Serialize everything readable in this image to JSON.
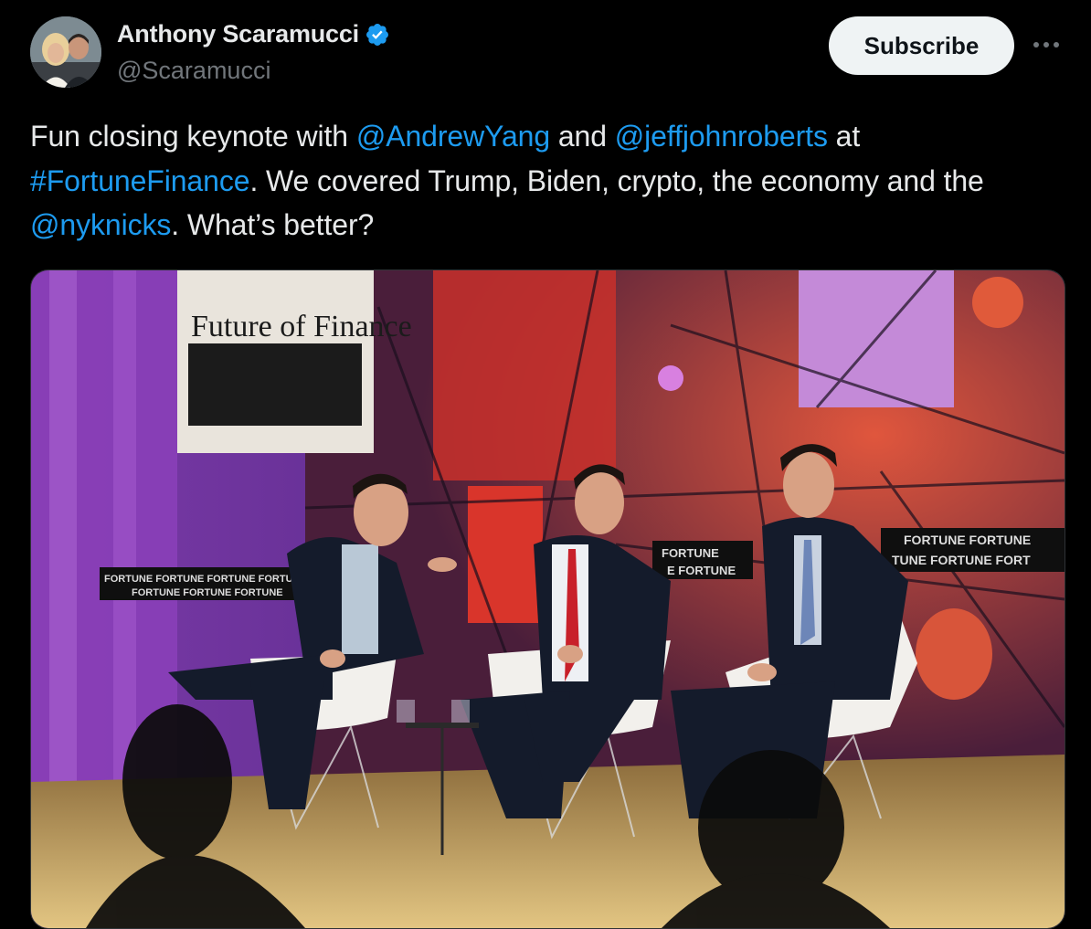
{
  "author": {
    "display_name": "Anthony Scaramucci",
    "handle": "@Scaramucci",
    "verified": true,
    "avatar_icon": "profile-photo"
  },
  "actions": {
    "subscribe_label": "Subscribe",
    "more_icon": "more-horizontal-icon"
  },
  "tweet": {
    "segments": [
      {
        "text": "Fun closing keynote with ",
        "type": "text"
      },
      {
        "text": "@AndrewYang",
        "type": "mention"
      },
      {
        "text": " and ",
        "type": "text"
      },
      {
        "text": "@jeffjohnroberts",
        "type": "mention"
      },
      {
        "text": " at ",
        "type": "text"
      },
      {
        "text": "#FortuneFinance",
        "type": "hashtag"
      },
      {
        "text": ". We covered Trump, Biden, crypto, the economy and the ",
        "type": "text"
      },
      {
        "text": "@nyknicks",
        "type": "mention"
      },
      {
        "text": ". What’s better?",
        "type": "text"
      }
    ]
  },
  "media": {
    "sign_text": "Future of Finance",
    "banner_left_row1": "FORTUNE  FORTUNE  FORTUNE  FORTU",
    "banner_left_row2": "FORTUNE  FORTUNE  FORTUNE",
    "banner_mid_row1": "FORTUNE",
    "banner_mid_row2": "E  FORTUNE",
    "banner_right_row1": "FORTUNE  FORTUNE",
    "banner_right_row2": "TUNE  FORTUNE  FORT"
  },
  "colors": {
    "mention": "#1d9bf0",
    "verified": "#1d9bf0",
    "background": "#000000"
  }
}
